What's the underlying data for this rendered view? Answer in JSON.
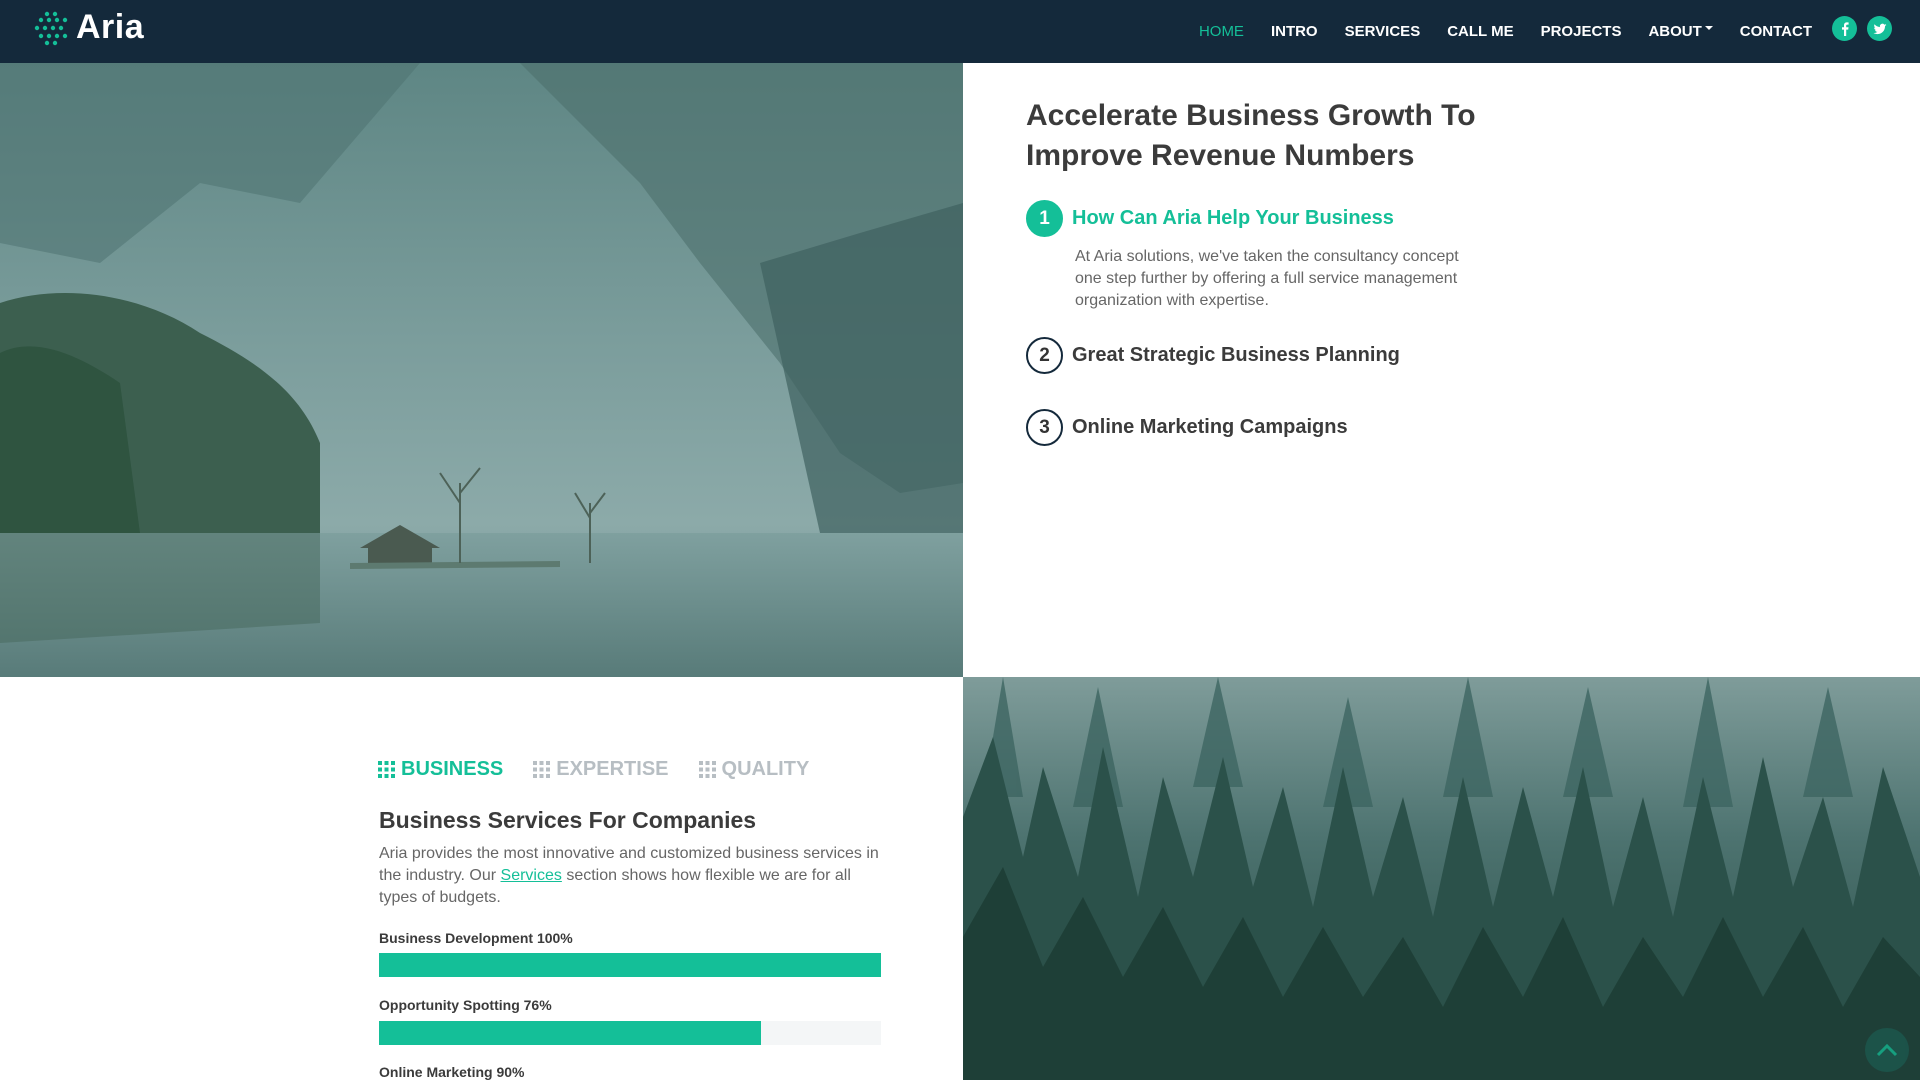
{
  "brand": {
    "name": "Aria"
  },
  "nav": {
    "items": [
      {
        "label": "HOME",
        "active": true
      },
      {
        "label": "INTRO"
      },
      {
        "label": "SERVICES"
      },
      {
        "label": "CALL ME"
      },
      {
        "label": "PROJECTS"
      },
      {
        "label": "ABOUT",
        "dropdown": true
      },
      {
        "label": "CONTACT"
      }
    ],
    "social": [
      "facebook-icon",
      "twitter-icon"
    ]
  },
  "intro": {
    "heading": "Accelerate Business Growth To Improve Revenue Numbers",
    "steps": [
      {
        "number": "1",
        "title": "How Can Aria Help Your Business",
        "description": "At Aria solutions, we've taken the consultancy concept one step further by offering a full service management organization with expertise.",
        "active": true
      },
      {
        "number": "2",
        "title": "Great Strategic Business Planning"
      },
      {
        "number": "3",
        "title": "Online Marketing Campaigns"
      }
    ]
  },
  "services": {
    "tabs": [
      {
        "label": "BUSINESS",
        "active": true
      },
      {
        "label": "EXPERTISE"
      },
      {
        "label": "QUALITY"
      }
    ],
    "title": "Business Services For Companies",
    "text_before": "Aria provides the most innovative and customized business services in the industry. Our ",
    "link": "Services",
    "text_after": " section shows how flexible we are for all types of budgets.",
    "bars": [
      {
        "label": "Business Development 100%",
        "value": 100
      },
      {
        "label": "Opportunity Spotting 76%",
        "value": 76
      },
      {
        "label": "Online Marketing 90%",
        "value": 90
      }
    ]
  },
  "colors": {
    "accent": "#14bf98",
    "navbar": "#14293b"
  }
}
